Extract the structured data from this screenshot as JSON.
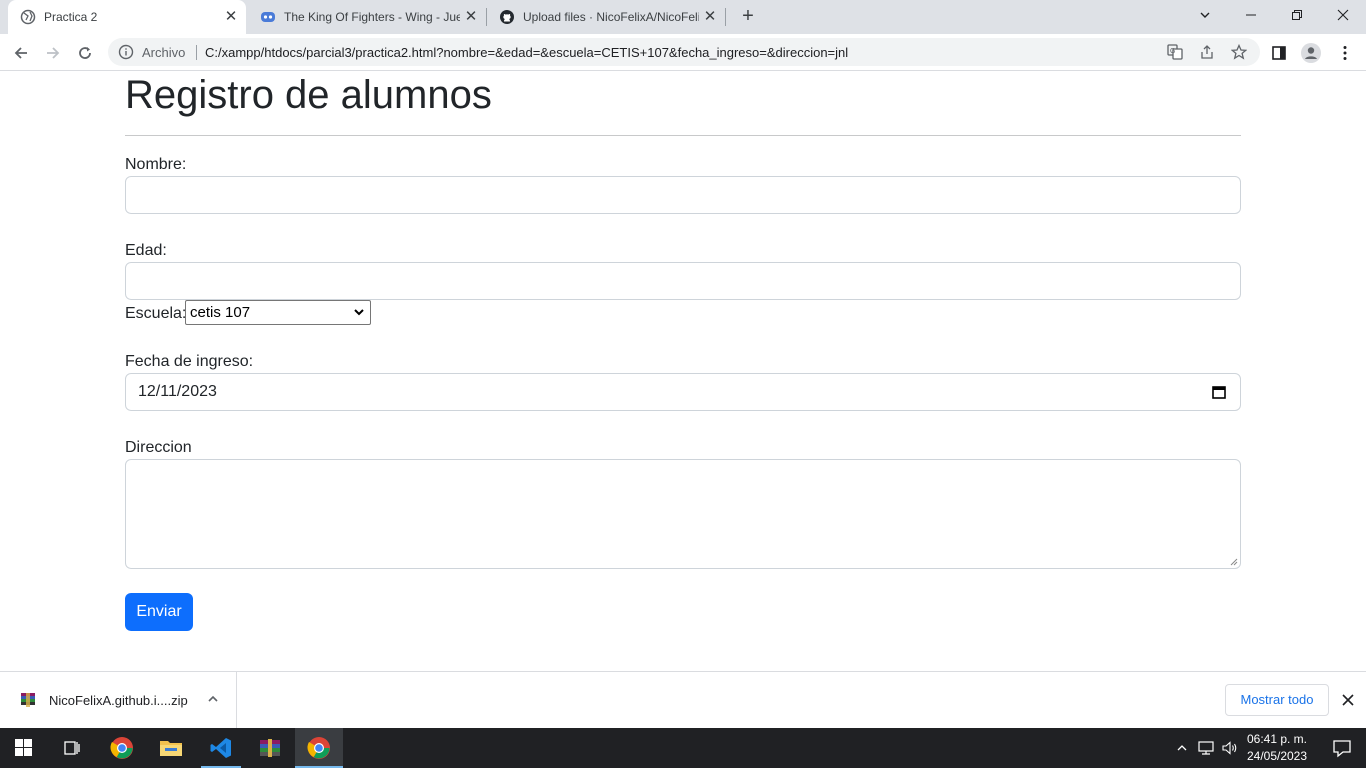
{
  "browser": {
    "tabs": [
      {
        "title": "Practica 2",
        "active": true,
        "icon": "globe-icon"
      },
      {
        "title": "The King Of Fighters - Wing - Jue",
        "active": false,
        "icon": "game-controller-icon"
      },
      {
        "title": "Upload files · NicoFelixA/NicoFeli",
        "active": false,
        "icon": "github-icon"
      }
    ],
    "omnibox": {
      "scheme_label": "Archivo",
      "url": "C:/xampp/htdocs/parcial3/practica2.html?nombre=&edad=&escuela=CETIS+107&fecha_ingreso=&direccion=jnl"
    }
  },
  "page": {
    "title": "Registro de alumnos",
    "form": {
      "nombre_label": "Nombre:",
      "nombre_value": "",
      "edad_label": "Edad:",
      "edad_value": "",
      "escuela_label": "Escuela:",
      "escuela_value": "cetis 107",
      "fecha_label": "Fecha de ingreso:",
      "fecha_value": "12/11/2023",
      "direccion_label": "Direccion",
      "direccion_value": "",
      "submit_label": "Enviar"
    }
  },
  "downloads": {
    "file_name": "NicoFelixA.github.i....zip",
    "show_all_label": "Mostrar todo"
  },
  "taskbar": {
    "time": "06:41 p. m.",
    "date": "24/05/2023"
  },
  "colors": {
    "primary_button": "#0d6efd",
    "taskbar": "#202124",
    "tabstrip": "#dee1e6"
  }
}
